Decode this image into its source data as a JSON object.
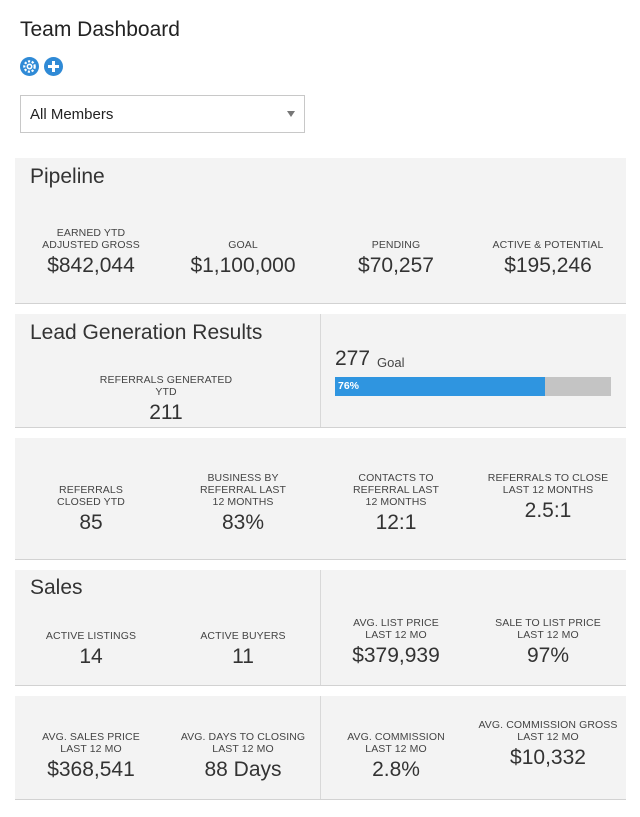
{
  "header": {
    "title": "Team Dashboard",
    "settings_icon": "gear-icon",
    "add_icon": "plus-circle-icon",
    "accent_color": "#2f8ad6"
  },
  "filter": {
    "selected": "All Members"
  },
  "pipeline": {
    "title": "Pipeline",
    "stats": [
      {
        "label": "EARNED YTD ADJUSTED GROSS",
        "value": "$842,044"
      },
      {
        "label": "GOAL",
        "value": "$1,100,000"
      },
      {
        "label": "PENDING",
        "value": "$70,257"
      },
      {
        "label": "ACTIVE & POTENTIAL",
        "value": "$195,246"
      }
    ]
  },
  "lead_generation": {
    "title": "Lead Generation Results",
    "referrals_label": "REFERRALS GENERATED YTD",
    "referrals_value": "211",
    "goal_value": "277",
    "goal_label": "Goal",
    "progress_label": "76%",
    "progress_percent": 76,
    "progress_color": "#2f95e0"
  },
  "referrals": {
    "stats": [
      {
        "label": "REFERRALS CLOSED YTD",
        "value": "85"
      },
      {
        "label": "BUSINESS BY REFERRAL LAST 12 MONTHS",
        "value": "83%"
      },
      {
        "label": "CONTACTS TO REFERRAL LAST 12 MONTHS",
        "value": "12:1"
      },
      {
        "label": "REFERRALS TO CLOSE LAST 12 MONTHS",
        "value": "2.5:1"
      }
    ]
  },
  "sales": {
    "title": "Sales",
    "stats": [
      {
        "label": "ACTIVE LISTINGS",
        "value": "14"
      },
      {
        "label": "ACTIVE BUYERS",
        "value": "11"
      },
      {
        "label": "AVG. LIST PRICE LAST 12 MO",
        "value": "$379,939"
      },
      {
        "label": "SALE TO LIST PRICE LAST 12 MO",
        "value": "97%"
      }
    ]
  },
  "averages": {
    "stats": [
      {
        "label": "AVG. SALES PRICE LAST 12 MO",
        "value": "$368,541"
      },
      {
        "label": "AVG. DAYS TO CLOSING LAST 12 MO",
        "value": "88 Days"
      },
      {
        "label": "AVG. COMMISSION LAST 12 MO",
        "value": "2.8%"
      },
      {
        "label": "AVG. COMMISSION GROSS LAST 12 MO",
        "value": "$10,332"
      }
    ]
  }
}
